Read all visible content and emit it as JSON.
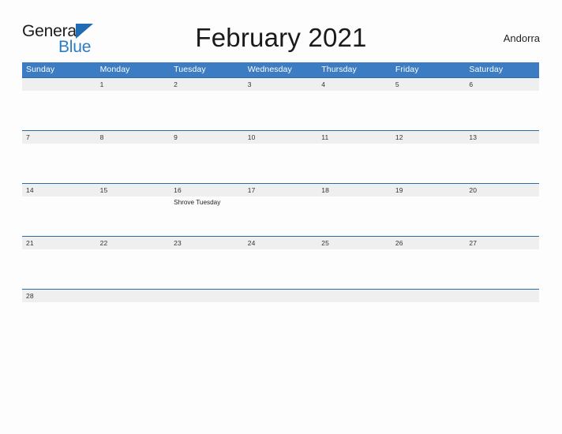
{
  "brand": {
    "word_top": "General",
    "word_bottom": "Blue",
    "triangle_color": "#1f6bb4",
    "blue_text_color": "#2b7cc4"
  },
  "header": {
    "title": "February 2021",
    "country": "Andorra"
  },
  "theme": {
    "header_blue": "#3b7cc2",
    "row_rule_blue": "#2b6ca8",
    "date_band_gray": "#efefef",
    "page_background": "#fdfdfd"
  },
  "calendar": {
    "weekday_headers": [
      "Sunday",
      "Monday",
      "Tuesday",
      "Wednesday",
      "Thursday",
      "Friday",
      "Saturday"
    ],
    "weeks": [
      [
        {
          "date": "",
          "events": []
        },
        {
          "date": "1",
          "events": []
        },
        {
          "date": "2",
          "events": []
        },
        {
          "date": "3",
          "events": []
        },
        {
          "date": "4",
          "events": []
        },
        {
          "date": "5",
          "events": []
        },
        {
          "date": "6",
          "events": []
        }
      ],
      [
        {
          "date": "7",
          "events": []
        },
        {
          "date": "8",
          "events": []
        },
        {
          "date": "9",
          "events": []
        },
        {
          "date": "10",
          "events": []
        },
        {
          "date": "11",
          "events": []
        },
        {
          "date": "12",
          "events": []
        },
        {
          "date": "13",
          "events": []
        }
      ],
      [
        {
          "date": "14",
          "events": []
        },
        {
          "date": "15",
          "events": []
        },
        {
          "date": "16",
          "events": [
            "Shrove Tuesday"
          ]
        },
        {
          "date": "17",
          "events": []
        },
        {
          "date": "18",
          "events": []
        },
        {
          "date": "19",
          "events": []
        },
        {
          "date": "20",
          "events": []
        }
      ],
      [
        {
          "date": "21",
          "events": []
        },
        {
          "date": "22",
          "events": []
        },
        {
          "date": "23",
          "events": []
        },
        {
          "date": "24",
          "events": []
        },
        {
          "date": "25",
          "events": []
        },
        {
          "date": "26",
          "events": []
        },
        {
          "date": "27",
          "events": []
        }
      ],
      [
        {
          "date": "28",
          "events": []
        },
        {
          "date": "",
          "events": []
        },
        {
          "date": "",
          "events": []
        },
        {
          "date": "",
          "events": []
        },
        {
          "date": "",
          "events": []
        },
        {
          "date": "",
          "events": []
        },
        {
          "date": "",
          "events": []
        }
      ]
    ]
  }
}
